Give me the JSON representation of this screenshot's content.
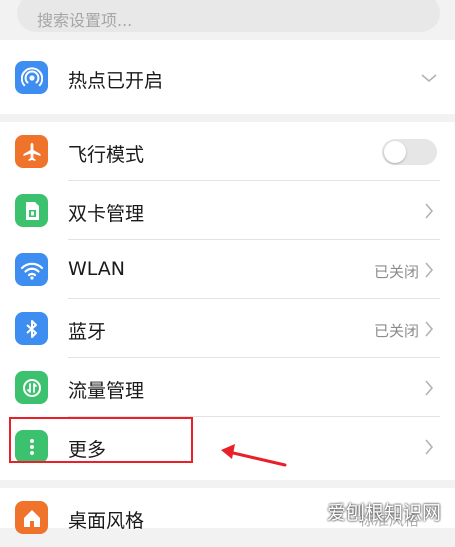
{
  "search": {
    "placeholder": "搜索设置项..."
  },
  "hotspot": {
    "label": "热点已开启",
    "icon": "hotspot-icon"
  },
  "settings": [
    {
      "label": "飞行模式",
      "icon": "airplane-icon",
      "color": "#f0732b",
      "toggle": false
    },
    {
      "label": "双卡管理",
      "icon": "sim-card-icon",
      "color": "#3cc26e"
    },
    {
      "label": "WLAN",
      "icon": "wifi-icon",
      "color": "#3d8ef0",
      "status": "已关闭"
    },
    {
      "label": "蓝牙",
      "icon": "bluetooth-icon",
      "color": "#3d8ef0",
      "status": "已关闭"
    },
    {
      "label": "流量管理",
      "icon": "data-usage-icon",
      "color": "#3cc26e"
    },
    {
      "label": "更多",
      "icon": "more-icon",
      "color": "#3cc26e"
    }
  ],
  "display": {
    "label": "桌面风格",
    "status": "标准风格",
    "icon": "home-screen-icon",
    "color": "#f0732b"
  },
  "watermark": "爱刨根知识网",
  "colors": {
    "highlight": "#e8202a",
    "arrow": "#e8202a"
  }
}
